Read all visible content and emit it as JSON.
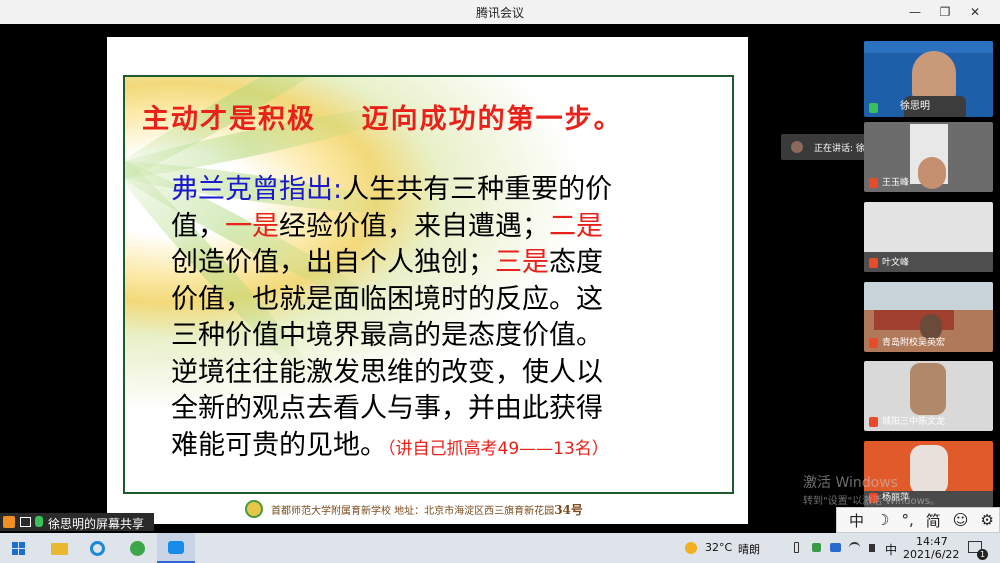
{
  "window": {
    "title": "腾讯会议"
  },
  "slide": {
    "heading": "主动才是积极    迈向成功的第一步。",
    "body": [
      [
        {
          "t": "弗兰克曾指出:",
          "c": "blue"
        },
        {
          "t": "人生共有三种重要的价"
        }
      ],
      [
        {
          "t": "值，"
        },
        {
          "t": "一是",
          "c": "red"
        },
        {
          "t": "经验价值，来自遭遇；"
        },
        {
          "t": "二是",
          "c": "red"
        }
      ],
      [
        {
          "t": "创造价值，出自个人独创；"
        },
        {
          "t": "三是",
          "c": "red"
        },
        {
          "t": "态度"
        }
      ],
      [
        {
          "t": "价值，也就是面临困境时的反应。这"
        }
      ],
      [
        {
          "t": "三种价值中境界最高的是态度价值。"
        }
      ],
      [
        {
          "t": "逆境往往能激发思维的改变，使人以"
        }
      ],
      [
        {
          "t": "全新的观点去看人与事，并由此获得"
        }
      ],
      [
        {
          "t": "难能可贵的见地。"
        },
        {
          "t": "（讲自己抓高考49——13名）",
          "c": "note"
        }
      ]
    ],
    "footer_school": "首都师范大学附属育新学校 地址：北京市海淀区西三旗育新花园",
    "footer_number": "34号"
  },
  "participants": [
    {
      "name": "徐思明",
      "mic": "on"
    },
    {
      "name": "王玉峰",
      "mic": "muted"
    },
    {
      "name": "叶文峰",
      "mic": "muted"
    },
    {
      "name": "青岛附校吴英宏",
      "mic": "muted"
    },
    {
      "name": "城阳三中陈文龙",
      "mic": "muted"
    },
    {
      "name": "杨丽萍",
      "mic": "muted"
    }
  ],
  "speaking": {
    "label": "正在讲话: 徐思明;"
  },
  "watermark": {
    "line1": "激活 Windows",
    "line2": "转到\"设置\"以激活 Windows。"
  },
  "screen_share": {
    "label": "徐思明的屏幕共享"
  },
  "ime": {
    "items": [
      "中",
      "☽",
      "°,",
      "简",
      "☺",
      "⚙"
    ]
  },
  "tray": {
    "temperature": "32°C",
    "weather": "晴朗",
    "lang": "中",
    "time": "14:47",
    "date": "2021/6/22",
    "notifications": "1"
  }
}
